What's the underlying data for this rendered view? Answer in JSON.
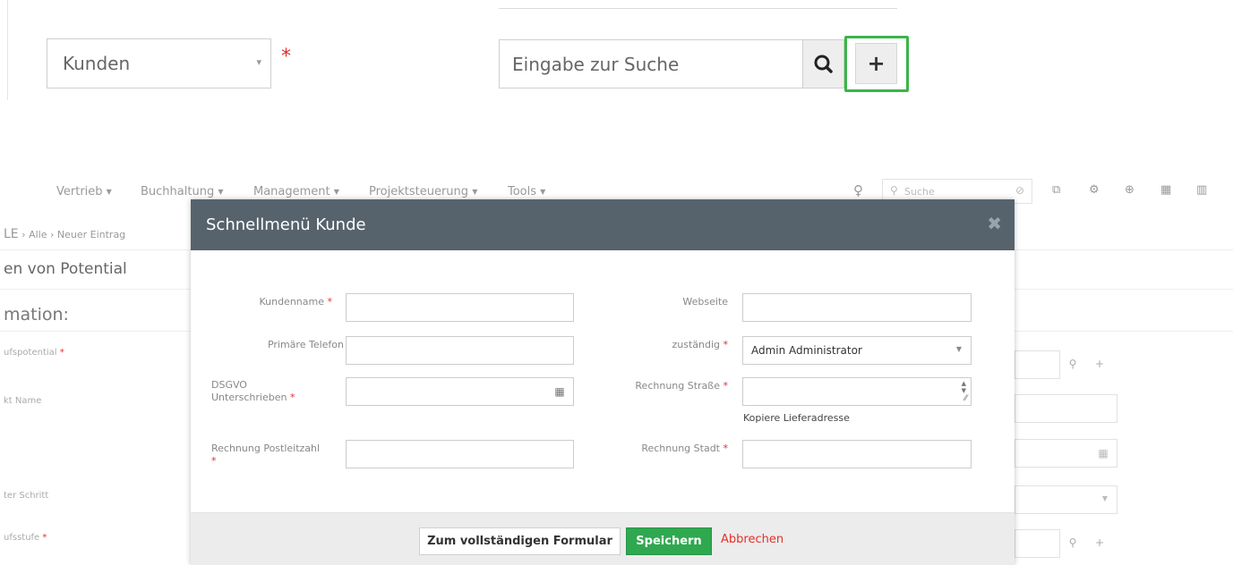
{
  "zoom_widget": {
    "select_value": "Kunden",
    "select_arrow": "▾",
    "required_mark": "*",
    "search_placeholder": "Eingabe zur Suche",
    "highlight_color": "#3bb54a"
  },
  "navbar": {
    "items": [
      "Vertrieb",
      "Buchhaltung",
      "Management",
      "Projektsteuerung",
      "Tools"
    ],
    "search_placeholder": "Suche"
  },
  "background": {
    "breadcrumb": [
      "LE",
      "Alle",
      "Neuer Eintrag"
    ],
    "title": "en von Potential",
    "section": "mation:",
    "labels": [
      "ufspotential",
      "kt Name",
      "ter Schritt",
      "ufsstufe"
    ]
  },
  "modal": {
    "title": "Schnellmenü Kunde",
    "fields": {
      "kundenname": {
        "label": "Kundenname",
        "value": ""
      },
      "primaere_telefon": {
        "label": "Primäre Telefon",
        "value": ""
      },
      "dsgvo": {
        "label_line1": "DSGVO",
        "label_line2": "Unterschrieben",
        "value": ""
      },
      "rechnung_plz": {
        "label": "Rechnung Postleitzahl",
        "value": ""
      },
      "webseite": {
        "label": "Webseite",
        "value": ""
      },
      "zustaendig": {
        "label": "zuständig",
        "value": "Admin Administrator"
      },
      "rechnung_strasse": {
        "label": "Rechnung Straße",
        "value": ""
      },
      "rechnung_stadt": {
        "label": "Rechnung Stadt",
        "value": ""
      }
    },
    "copy_link": "Kopiere Lieferadresse",
    "required_mark": "*",
    "buttons": {
      "full_form": "Zum vollständigen Formular",
      "save": "Speichern",
      "cancel": "Abbrechen"
    },
    "colors": {
      "header": "#56636d",
      "save": "#2fa84f",
      "cancel": "#e5312b",
      "required": "#e02d2d"
    }
  }
}
